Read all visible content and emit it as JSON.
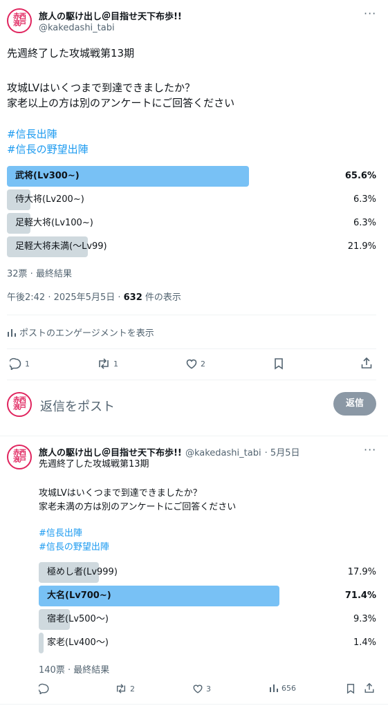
{
  "main_tweet": {
    "avatar_text": "赤西浪戸",
    "display_name": "旅人の駆け出し＠目指せ天下布歩!!",
    "handle": "@kakedashi_tabi",
    "more": "···",
    "text_line1": "先週終了した攻城戦第13期",
    "text_line2": "攻城LVはいくつまで到達できましたか？",
    "text_line3": "家老以上の方は別のアンケートにご回答ください",
    "hashtags": [
      "#信長出陣",
      "#信長の野望出陣"
    ],
    "poll": {
      "options": [
        {
          "label": "武将(Lv300~)",
          "percent": "65.6%",
          "fraction": 0.656,
          "winner": true
        },
        {
          "label": "侍大将(Lv200~)",
          "percent": "6.3%",
          "fraction": 0.063,
          "winner": false
        },
        {
          "label": "足軽大将(Lv100~)",
          "percent": "6.3%",
          "fraction": 0.063,
          "winner": false
        },
        {
          "label": "足軽大将未満(〜Lv99)",
          "percent": "21.9%",
          "fraction": 0.219,
          "winner": false
        }
      ],
      "summary": "32票 · 最終結果"
    },
    "timestamp": "午後2:42 · 2025年5月5日 · ",
    "views_count": "632",
    "views_label": " 件の表示",
    "engagement_link": "ポストのエンゲージメントを表示",
    "actions": {
      "replies": "1",
      "retweets": "1",
      "likes": "2"
    }
  },
  "reply_composer": {
    "placeholder": "返信をポスト",
    "button": "返信"
  },
  "second_tweet": {
    "avatar_text": "赤西浪戸",
    "display_name": "旅人の駆け出し＠目指せ天下布歩!!",
    "handle": "@kakedashi_tabi",
    "date": "· 5月5日",
    "more": "···",
    "text_line1": "先週終了した攻城戦第13期",
    "text_line2": "攻城LVはいくつまで到達できましたか？",
    "text_line3": "家老未満の方は別のアンケートにご回答ください",
    "hashtags": [
      "#信長出陣",
      "#信長の野望出陣"
    ],
    "poll": {
      "options": [
        {
          "label": "極めし者(Lv999)",
          "percent": "17.9%",
          "fraction": 0.179,
          "winner": false
        },
        {
          "label": "大名(Lv700~)",
          "percent": "71.4%",
          "fraction": 0.714,
          "winner": true
        },
        {
          "label": "宿老(Lv500〜)",
          "percent": "9.3%",
          "fraction": 0.093,
          "winner": false
        },
        {
          "label": "家老(Lv400〜)",
          "percent": "1.4%",
          "fraction": 0.014,
          "winner": false
        }
      ],
      "summary": "140票 · 最終結果"
    },
    "actions": {
      "replies": "",
      "retweets": "2",
      "likes": "3",
      "views": "656"
    }
  }
}
